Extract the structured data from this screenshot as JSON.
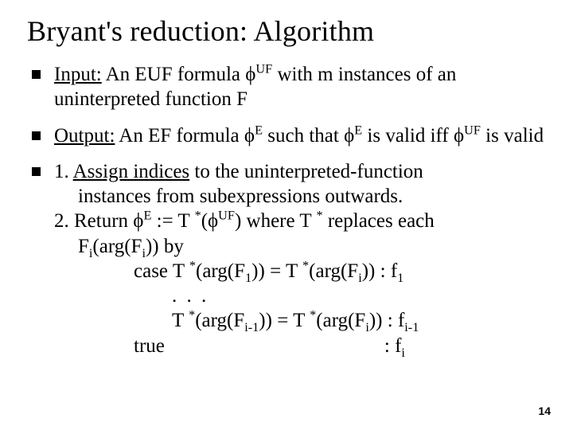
{
  "title": "Bryant's reduction: Algorithm",
  "bullets": {
    "b1_label": "Input:",
    "b1_rest": " An EUF formula ϕ",
    "b1_sup1": "UF",
    "b1_after": " with m instances of an uninterpreted function F",
    "b2_label": "Output:",
    "b2_rest": " An EF formula ϕ",
    "b2_sup1": "E",
    "b2_mid": " such that ϕ",
    "b2_sup2": "E",
    "b2_mid2": " is valid iff ϕ",
    "b2_sup3": "UF",
    "b2_end": " is valid",
    "b3_step1a": "1. ",
    "b3_step1u": "Assign indices",
    "b3_step1b": " to the uninterpreted-function",
    "b3_step1c": "instances from subexpressions outwards.",
    "b3_step2a": "2. Return ϕ",
    "b3_step2_sup1": "E",
    "b3_step2b": " := T ",
    "b3_step2_star1": "*",
    "b3_step2c": "(ϕ",
    "b3_step2_sup2": "UF",
    "b3_step2d": ") where T ",
    "b3_step2_star2": "*",
    "b3_step2e": " replaces each",
    "b3_step2_line2a": "F",
    "b3_step2_sub_i": "i",
    "b3_step2_line2b": "(arg(F",
    "b3_step2_line2c": ")) by",
    "case_a": "case T ",
    "case_star1": "*",
    "case_b": "(arg(F",
    "case_sub1": "1",
    "case_c": ")) = T ",
    "case_star2": "*",
    "case_d": "(arg(F",
    "case_sub_i": "i",
    "case_e": "))",
    "case_colon": "  : f",
    "case_fsub": "1",
    "dots": "   . . .",
    "case2_a": "T ",
    "case2_star1": "*",
    "case2_b": "(arg(F",
    "case2_sub_im1": "i-1",
    "case2_c": ")) = T ",
    "case2_star2": "*",
    "case2_d": "(arg(F",
    "case2_sub_i": "i",
    "case2_e": "))",
    "case2_colon": " : f",
    "case2_fsub": "i-1",
    "true_label": "true",
    "true_colon": ": f",
    "true_sub": "i"
  },
  "pagenum": "14"
}
